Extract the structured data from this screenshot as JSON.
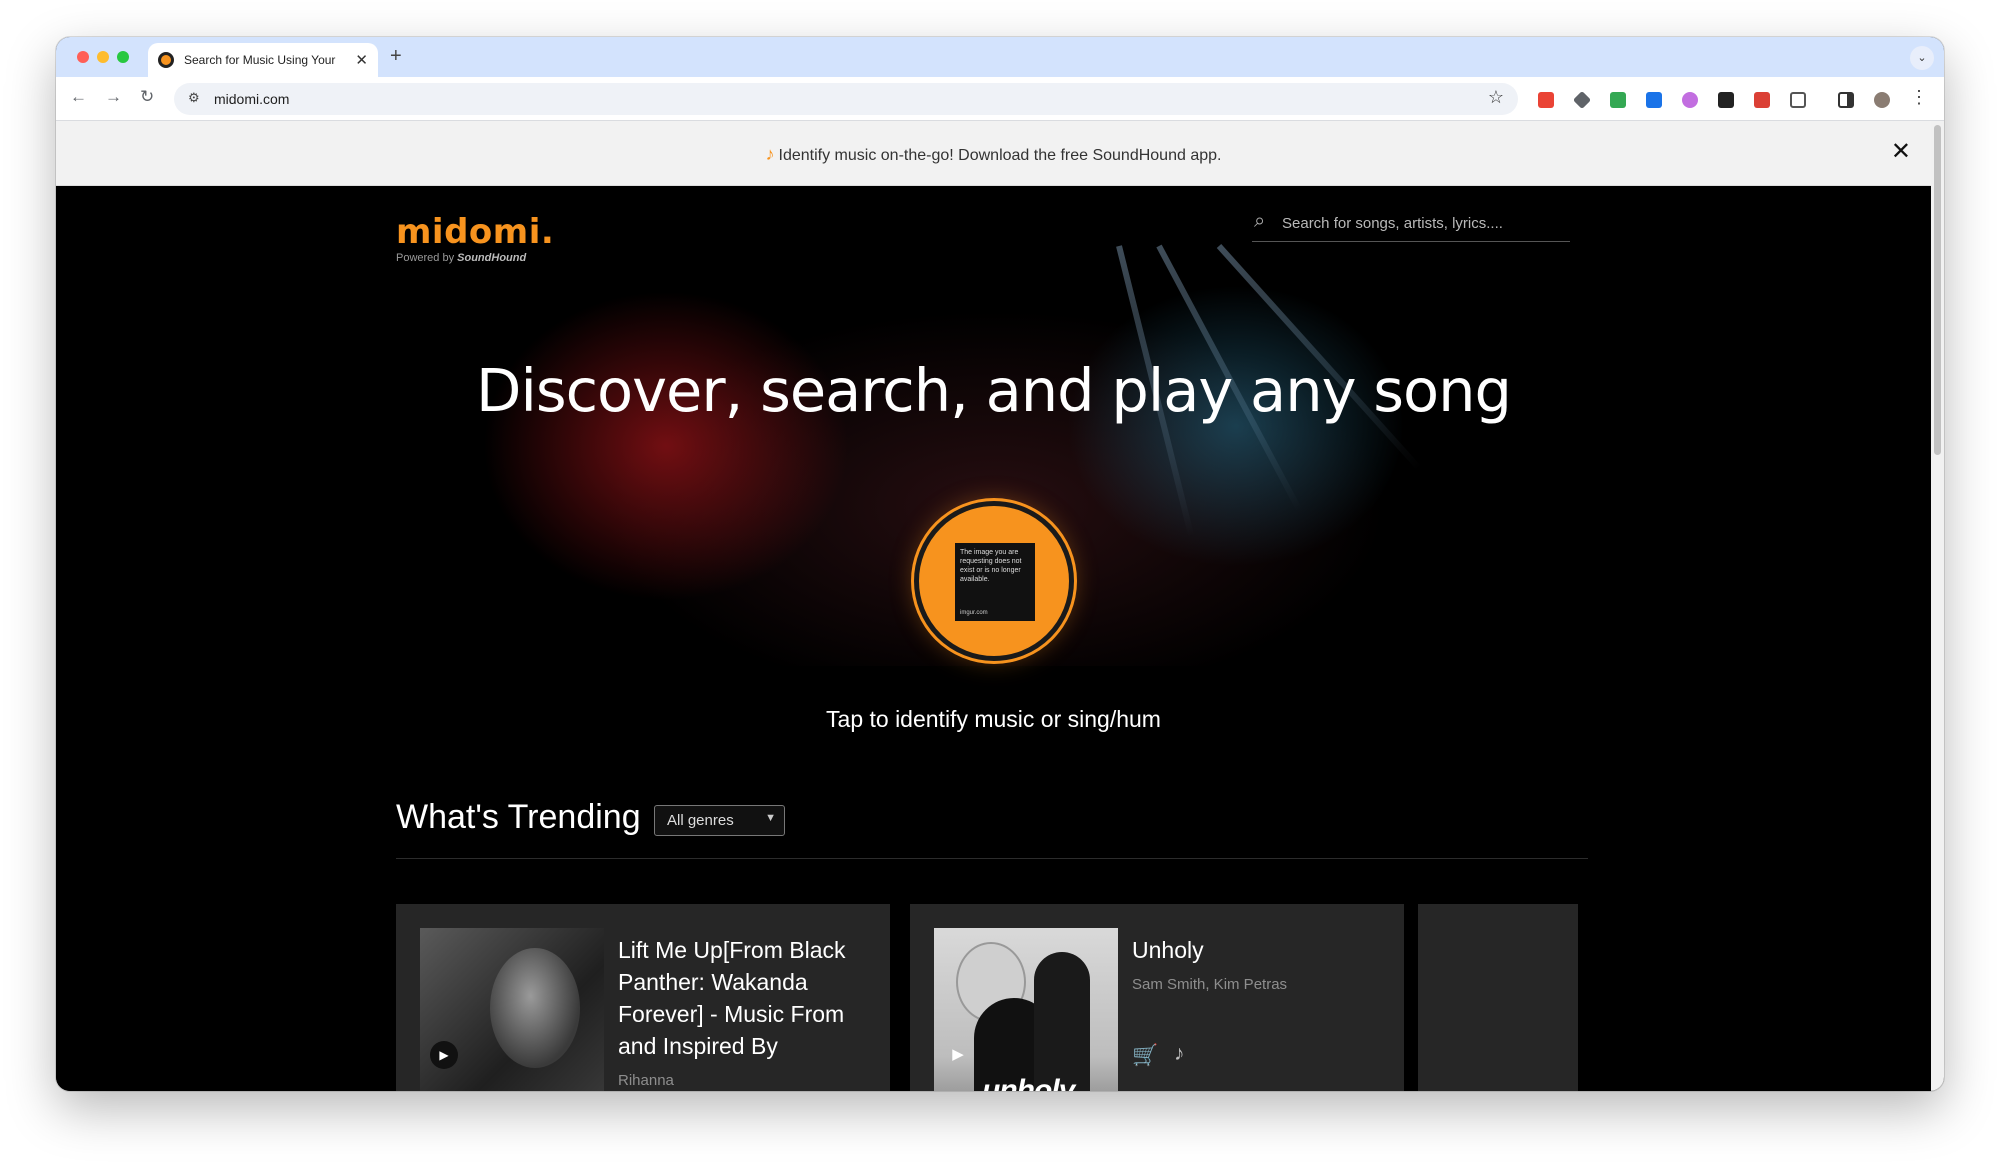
{
  "browser": {
    "tab_title": "Search for Music Using Your",
    "tab_close": "✕",
    "new_tab": "+",
    "tab_menu": "⌄",
    "url": "midomi.com",
    "nav": {
      "back": "←",
      "forward": "→",
      "reload": "↻"
    },
    "extensions": [
      "gmail-icon",
      "layers-icon",
      "image-icon",
      "grammar-icon",
      "circle-icon",
      "notion-icon",
      "todoist-icon",
      "puzzle-icon",
      "sidepanel-icon",
      "profile-avatar-icon"
    ],
    "colors": {
      "tab_strip": "#d3e3fd",
      "omnibox": "#eff2f7"
    }
  },
  "banner": {
    "text": "Identify music on-the-go! Download the free SoundHound app.",
    "note_icon": "♪",
    "close": "✕"
  },
  "header": {
    "logo": "midomi.",
    "powered_by": "Powered by",
    "powered_brand": "SoundHound",
    "search_placeholder": "Search for songs, artists, lyrics...."
  },
  "hero": {
    "headline": "Discover, search, and play any song",
    "image_error_text": "The image you are requesting does not exist or is no longer available.",
    "image_error_link": "imgur.com",
    "tap_text": "Tap to identify music or sing/hum"
  },
  "trending": {
    "title": "What's Trending",
    "genre_selected": "All genres",
    "cards": [
      {
        "title": "Lift Me Up[From Black Panther: Wakanda Forever] - Music From and Inspired By",
        "artist": "Rihanna"
      },
      {
        "title": "Unholy",
        "artist": "Sam Smith, Kim Petras",
        "art_word": "unholy"
      }
    ]
  },
  "colors": {
    "brand_orange": "#f7931e",
    "page_bg": "#000000",
    "card_bg": "#262626"
  }
}
